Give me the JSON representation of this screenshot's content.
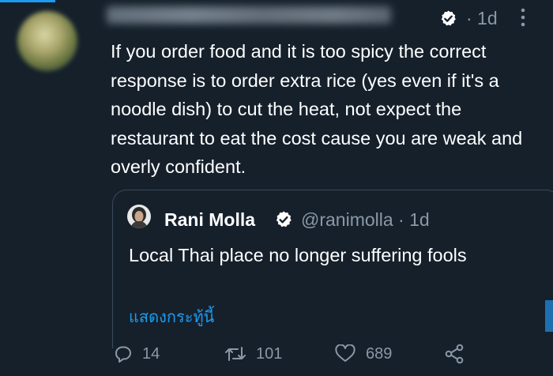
{
  "tweet": {
    "time": "· 1d",
    "text": "If you order food and it is too spicy the correct response is to order extra rice (yes even if it's a noodle dish) to cut the heat, not expect the restaurant to eat the cost cause you are weak and overly confident."
  },
  "quote": {
    "name": "Rani Molla",
    "handle": "@ranimolla · 1d",
    "text": "Local Thai place no longer suffering fools",
    "translate_label": "แสดงกระทู้นี้"
  },
  "actions": {
    "reply_count": "14",
    "retweet_count": "101",
    "like_count": "689"
  },
  "icons": {
    "verified": "verified-badge-icon",
    "more": "more-icon",
    "reply": "reply-icon",
    "retweet": "retweet-icon",
    "like": "like-icon",
    "share": "share-icon"
  },
  "colors": {
    "background": "#15202b",
    "accent": "#1d9bf0",
    "secondary_text": "#8b98a5"
  }
}
